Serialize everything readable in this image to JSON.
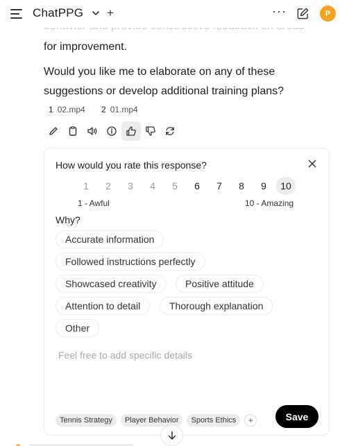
{
  "header": {
    "title": "ChatPPG",
    "avatar_initial": "P",
    "avatar_color": "#f6a21c"
  },
  "message": {
    "faded_line": "behavior and provide constructive feedback on areas",
    "lines": [
      "for improvement.",
      "Would you like me to elaborate on any of these",
      "suggestions or develop additional training plans?"
    ]
  },
  "files": [
    {
      "num": "1",
      "name": "02.mp4"
    },
    {
      "num": "2",
      "name": "01.mp4"
    }
  ],
  "actions": [
    "pencil-icon",
    "clipboard-icon",
    "speaker-icon",
    "info-icon",
    "thumbs-up-icon",
    "thumbs-down-icon",
    "regenerate-icon"
  ],
  "feedback": {
    "question": "How would you rate this response?",
    "ratings": [
      "1",
      "2",
      "3",
      "4",
      "5",
      "6",
      "7",
      "8",
      "9",
      "10"
    ],
    "selected_rating": "10",
    "scale_low": "1 - Awful",
    "scale_high": "10 - Amazing",
    "why_label": "Why?",
    "reasons": [
      "Accurate information",
      "Followed instructions perfectly",
      "Showcased creativity",
      "Positive attitude",
      "Attention to detail",
      "Thorough explanation",
      "Other"
    ],
    "details_placeholder": "Feel free to add specific details",
    "tags": [
      "Tennis Strategy",
      "Player Behavior",
      "Sports Ethics"
    ],
    "tag_add": "+",
    "save_label": "Save"
  }
}
